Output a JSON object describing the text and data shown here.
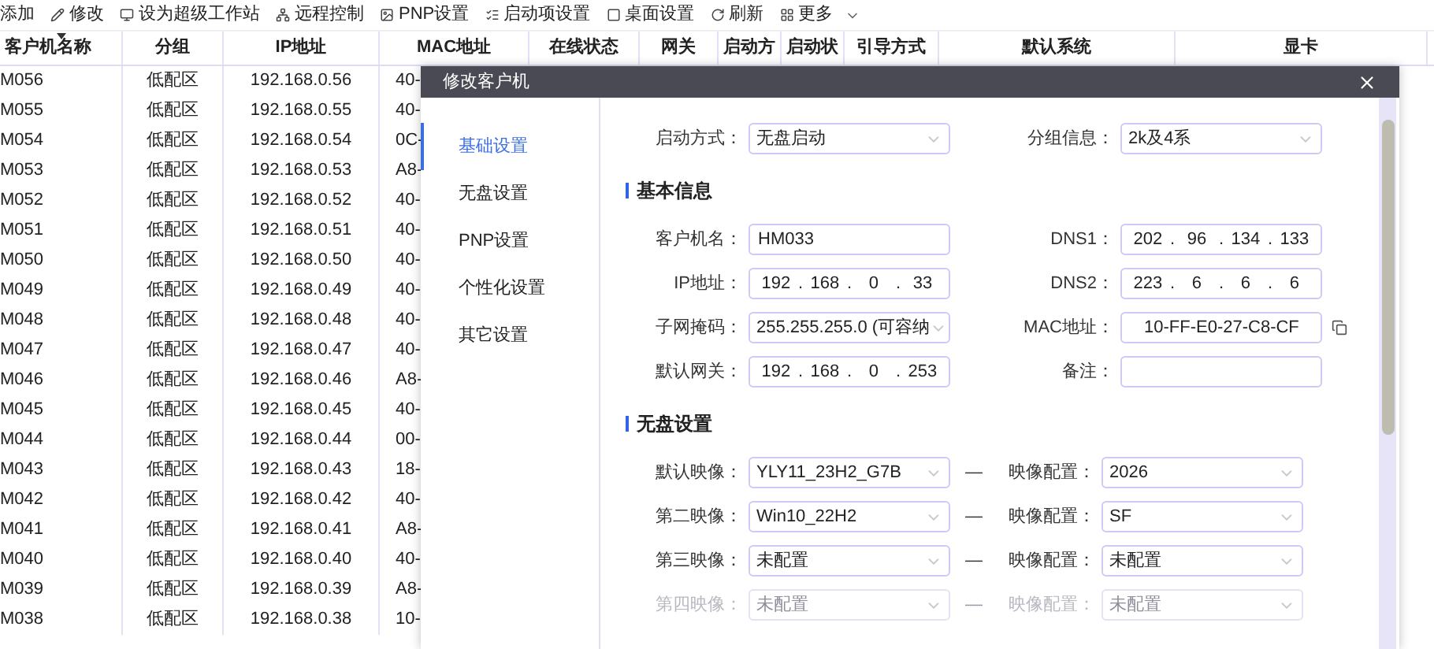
{
  "toolbar": [
    {
      "label": "添加"
    },
    {
      "label": "修改"
    },
    {
      "label": "设为超级工作站"
    },
    {
      "label": "远程控制"
    },
    {
      "label": "PNP设置"
    },
    {
      "label": "启动项设置"
    },
    {
      "label": "桌面设置"
    },
    {
      "label": "刷新"
    },
    {
      "label": "更多",
      "menu": true
    }
  ],
  "table": {
    "columns": [
      "客户机名称",
      "分组",
      "IP地址",
      "MAC地址",
      "在线状态",
      "网关",
      "启动方",
      "启动状",
      "引导方式",
      "默认系统",
      "显卡"
    ],
    "rows": [
      [
        "M056",
        "低配区",
        "192.168.0.56",
        "40-"
      ],
      [
        "M055",
        "低配区",
        "192.168.0.55",
        "40-"
      ],
      [
        "M054",
        "低配区",
        "192.168.0.54",
        "0C-"
      ],
      [
        "M053",
        "低配区",
        "192.168.0.53",
        "A8-"
      ],
      [
        "M052",
        "低配区",
        "192.168.0.52",
        "40-"
      ],
      [
        "M051",
        "低配区",
        "192.168.0.51",
        "40-"
      ],
      [
        "M050",
        "低配区",
        "192.168.0.50",
        "40-"
      ],
      [
        "M049",
        "低配区",
        "192.168.0.49",
        "40-"
      ],
      [
        "M048",
        "低配区",
        "192.168.0.48",
        "40-"
      ],
      [
        "M047",
        "低配区",
        "192.168.0.47",
        "40-"
      ],
      [
        "M046",
        "低配区",
        "192.168.0.46",
        "A8-"
      ],
      [
        "M045",
        "低配区",
        "192.168.0.45",
        "40-"
      ],
      [
        "M044",
        "低配区",
        "192.168.0.44",
        "00-"
      ],
      [
        "M043",
        "低配区",
        "192.168.0.43",
        "18-"
      ],
      [
        "M042",
        "低配区",
        "192.168.0.42",
        "40-"
      ],
      [
        "M041",
        "低配区",
        "192.168.0.41",
        "A8-"
      ],
      [
        "M040",
        "低配区",
        "192.168.0.40",
        "40-"
      ],
      [
        "M039",
        "低配区",
        "192.168.0.39",
        "A8-"
      ],
      [
        "M038",
        "低配区",
        "192.168.0.38",
        "10-"
      ]
    ]
  },
  "dialog": {
    "title": "修改客户机",
    "nav": [
      {
        "label": "基础设置",
        "selected": true
      },
      {
        "label": "无盘设置",
        "selected": false
      },
      {
        "label": "PNP设置",
        "selected": false
      },
      {
        "label": "个性化设置",
        "selected": false
      },
      {
        "label": "其它设置",
        "selected": false
      }
    ],
    "top_row": {
      "fields": [
        {
          "label": "启动方式：",
          "kind": "select",
          "value": "无盘启动",
          "disabled": false
        },
        {
          "label": "分组信息：",
          "kind": "select",
          "value": "2k及4系",
          "disabled": false
        }
      ]
    },
    "sections": [
      {
        "title": "基本信息",
        "rows": [
          {
            "fields": [
              {
                "label": "客户机名：",
                "kind": "text",
                "value": "HM033",
                "disabled": false
              },
              {
                "label": "DNS1：",
                "kind": "ip",
                "parts": [
                  "202",
                  "96",
                  "134",
                  "133"
                ],
                "separator": ".",
                "disabled": false
              }
            ]
          },
          {
            "fields": [
              {
                "label": "IP地址：",
                "kind": "ip",
                "parts": [
                  "192",
                  "168",
                  "0",
                  "33"
                ],
                "separator": ".",
                "disabled": false
              },
              {
                "label": "DNS2：",
                "kind": "ip",
                "parts": [
                  "223",
                  "6",
                  "6",
                  "6"
                ],
                "separator": ".",
                "disabled": false
              }
            ]
          },
          {
            "fields": [
              {
                "label": "子网掩码：",
                "kind": "select",
                "value": "255.255.255.0  (可容纳",
                "disabled": false
              },
              {
                "label": "MAC地址：",
                "kind": "text",
                "value": "10-FF-E0-27-C8-CF",
                "disabled": false,
                "copyable": true
              }
            ]
          },
          {
            "fields": [
              {
                "label": "默认网关：",
                "kind": "ip",
                "parts": [
                  "192",
                  "168",
                  "0",
                  "253"
                ],
                "separator": ".",
                "disabled": false
              },
              {
                "label": "备注：",
                "kind": "text",
                "disabled": false
              }
            ]
          }
        ]
      },
      {
        "title": "无盘设置",
        "rows": [
          {
            "separator": "—",
            "fields": [
              {
                "label": "默认映像：",
                "kind": "select",
                "value": "YLY11_23H2_G7B",
                "disabled": false
              },
              {
                "label": "映像配置：",
                "kind": "select",
                "value": "2026",
                "disabled": false
              }
            ]
          },
          {
            "separator": "—",
            "fields": [
              {
                "label": "第二映像：",
                "kind": "select",
                "value": "Win10_22H2",
                "disabled": false
              },
              {
                "label": "映像配置：",
                "kind": "select",
                "value": "SF",
                "disabled": false
              }
            ]
          },
          {
            "separator": "—",
            "fields": [
              {
                "label": "第三映像：",
                "kind": "select",
                "value": "未配置",
                "disabled": false
              },
              {
                "label": "映像配置：",
                "kind": "select",
                "value": "未配置",
                "disabled": false
              }
            ]
          },
          {
            "separator": "—",
            "fields": [
              {
                "label": "第四映像：",
                "kind": "select",
                "value": "未配置",
                "disabled": true
              },
              {
                "label": "映像配置：",
                "kind": "select",
                "value": "未配置",
                "disabled": true
              }
            ]
          }
        ]
      }
    ]
  }
}
